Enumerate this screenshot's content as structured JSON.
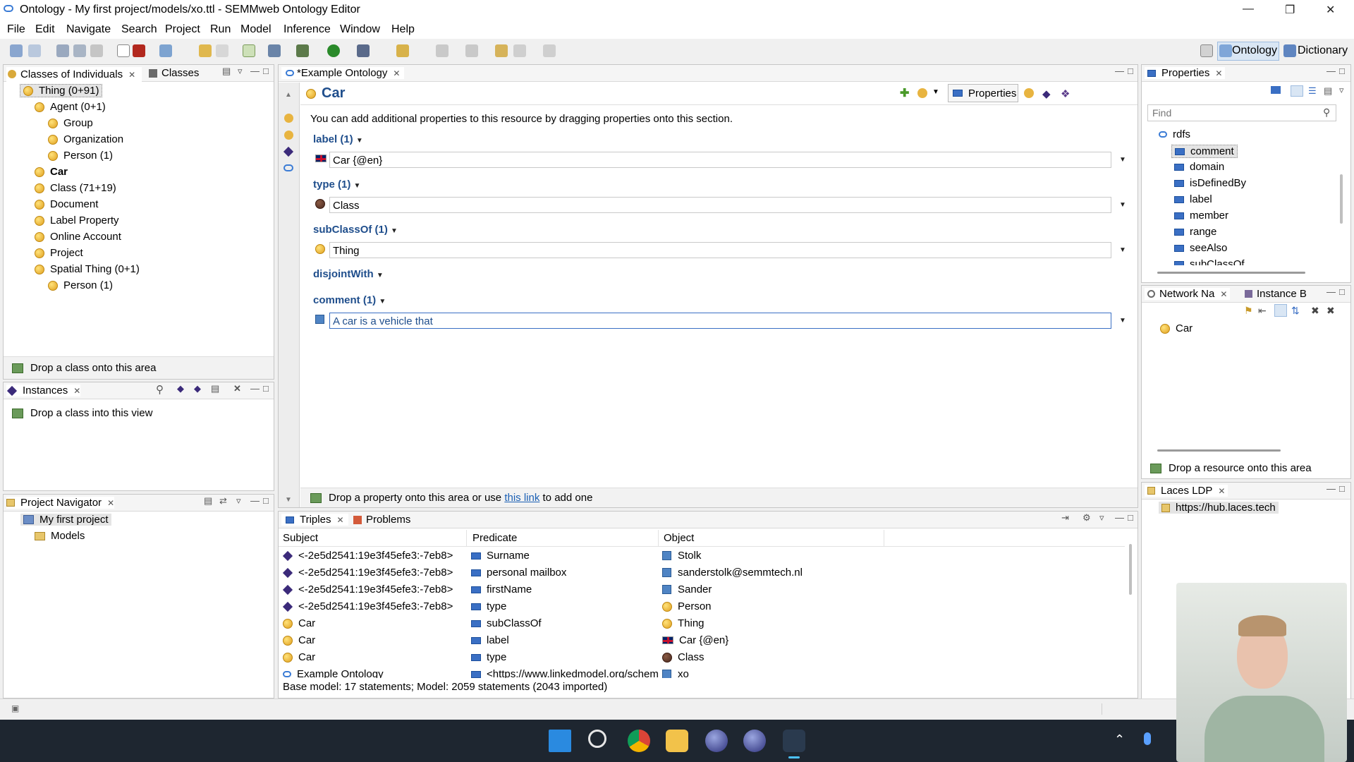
{
  "window": {
    "title": "Ontology - My first project/models/xo.ttl - SEMMweb Ontology Editor"
  },
  "menu": [
    "File",
    "Edit",
    "Navigate",
    "Search",
    "Project",
    "Run",
    "Model",
    "Inference",
    "Window",
    "Help"
  ],
  "perspectives": {
    "ontology": "Ontology",
    "dictionary": "Dictionary"
  },
  "classes_panel": {
    "tab1": "Classes of Individuals",
    "tab2": "Classes",
    "items": [
      {
        "label": "Thing (0+91)"
      },
      {
        "label": "Agent (0+1)"
      },
      {
        "label": "Group"
      },
      {
        "label": "Organization"
      },
      {
        "label": "Person (1)"
      },
      {
        "label": "Car"
      },
      {
        "label": "Class (71+19)"
      },
      {
        "label": "Document"
      },
      {
        "label": "Label Property"
      },
      {
        "label": "Online Account"
      },
      {
        "label": "Project"
      },
      {
        "label": "Spatial Thing (0+1)"
      },
      {
        "label": "Person (1)"
      }
    ],
    "drop_text": "Drop a class onto this area"
  },
  "instances_panel": {
    "tab": "Instances",
    "drop_text": "Drop a class into this view"
  },
  "project_panel": {
    "tab": "Project Navigator",
    "items": [
      "My first project",
      "Models"
    ]
  },
  "editor": {
    "tab": "*Example Ontology",
    "title": "Car",
    "properties_tab": "Properties",
    "info": "You can add additional properties to this resource by dragging properties onto this section.",
    "sections": [
      {
        "heading": "label (1)",
        "value": "Car {@en}",
        "icon": "flag-icon"
      },
      {
        "heading": "type (1)",
        "value": "Class",
        "icon": "class-ball-icon"
      },
      {
        "heading": "subClassOf (1)",
        "value": "Thing",
        "icon": "class-ball-icon"
      },
      {
        "heading": "disjointWith",
        "value": "",
        "icon": ""
      },
      {
        "heading": "comment (1)",
        "value": "A car is a vehicle that",
        "icon": "literal-icon"
      }
    ],
    "footer_prefix": "Drop a property onto this area or use ",
    "footer_link": "this link",
    "footer_suffix": " to add one"
  },
  "properties_panel": {
    "tab": "Properties",
    "search_placeholder": "Find",
    "root": "rdfs",
    "items": [
      "comment",
      "domain",
      "isDefinedBy",
      "label",
      "member",
      "range",
      "seeAlso",
      "subClassOf"
    ]
  },
  "network_panel": {
    "tab1": "Network Na",
    "tab2": "Instance B",
    "item": "Car",
    "drop_text": "Drop a resource onto this area"
  },
  "laces_panel": {
    "tab": "Laces LDP",
    "url": "https://hub.laces.tech"
  },
  "triples_panel": {
    "tab1": "Triples",
    "tab2": "Problems",
    "columns": [
      "Subject",
      "Predicate",
      "Object"
    ],
    "rows": [
      {
        "subject": "<-2e5d2541:19e3f45efe3:-7eb8>",
        "predicate": "Surname",
        "object": "Stolk"
      },
      {
        "subject": "<-2e5d2541:19e3f45efe3:-7eb8>",
        "predicate": "personal mailbox",
        "object": "sanderstolk@semmtech.nl"
      },
      {
        "subject": "<-2e5d2541:19e3f45efe3:-7eb8>",
        "predicate": "firstName",
        "object": "Sander"
      },
      {
        "subject": "<-2e5d2541:19e3f45efe3:-7eb8>",
        "predicate": "type",
        "object": "Person"
      },
      {
        "subject": "Car",
        "predicate": "subClassOf",
        "object": "Thing"
      },
      {
        "subject": "Car",
        "predicate": "label",
        "object": "Car {@en}"
      },
      {
        "subject": "Car",
        "predicate": "type",
        "object": "Class"
      },
      {
        "subject": "Example Ontology",
        "predicate": "<https://www.linkedmodel.org/schem",
        "object": "xo"
      }
    ],
    "status": "Base model: 17 statements; Model: 2059 statements (2043 imported)"
  },
  "colors": {
    "accent": "#1f4e8c",
    "selection": "#cfe3f7",
    "taskbar": "#1e2630"
  }
}
